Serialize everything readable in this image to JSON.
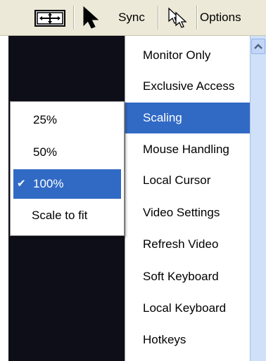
{
  "toolbar": {
    "fit_icon": "fit-window-icon",
    "pointer_icon": "pointer-arrow-icon",
    "sync_label": "Sync",
    "cursor_icon": "dual-cursor-icon",
    "options_label": "Options"
  },
  "options_menu": {
    "items": [
      {
        "label": "Monitor Only"
      },
      {
        "label": "Exclusive Access"
      },
      {
        "label": "Scaling"
      },
      {
        "label": "Mouse Handling"
      },
      {
        "label": "Local Cursor"
      },
      {
        "label": "Video Settings"
      },
      {
        "label": "Refresh Video"
      },
      {
        "label": "Soft Keyboard"
      },
      {
        "label": "Local Keyboard"
      },
      {
        "label": "Hotkeys"
      }
    ],
    "active_item": "Scaling"
  },
  "scaling_submenu": {
    "items": [
      {
        "label": "25%"
      },
      {
        "label": "50%"
      },
      {
        "label": "100%"
      },
      {
        "label": "Scale to fit"
      }
    ],
    "selected": "100%",
    "check_glyph": "✔"
  },
  "scrollbar": {
    "up_icon": "scroll-up-arrow-icon"
  },
  "colors": {
    "highlight": "#316ac5",
    "toolbar_bg": "#ece9d8",
    "remote_bg": "#0e0e18"
  }
}
